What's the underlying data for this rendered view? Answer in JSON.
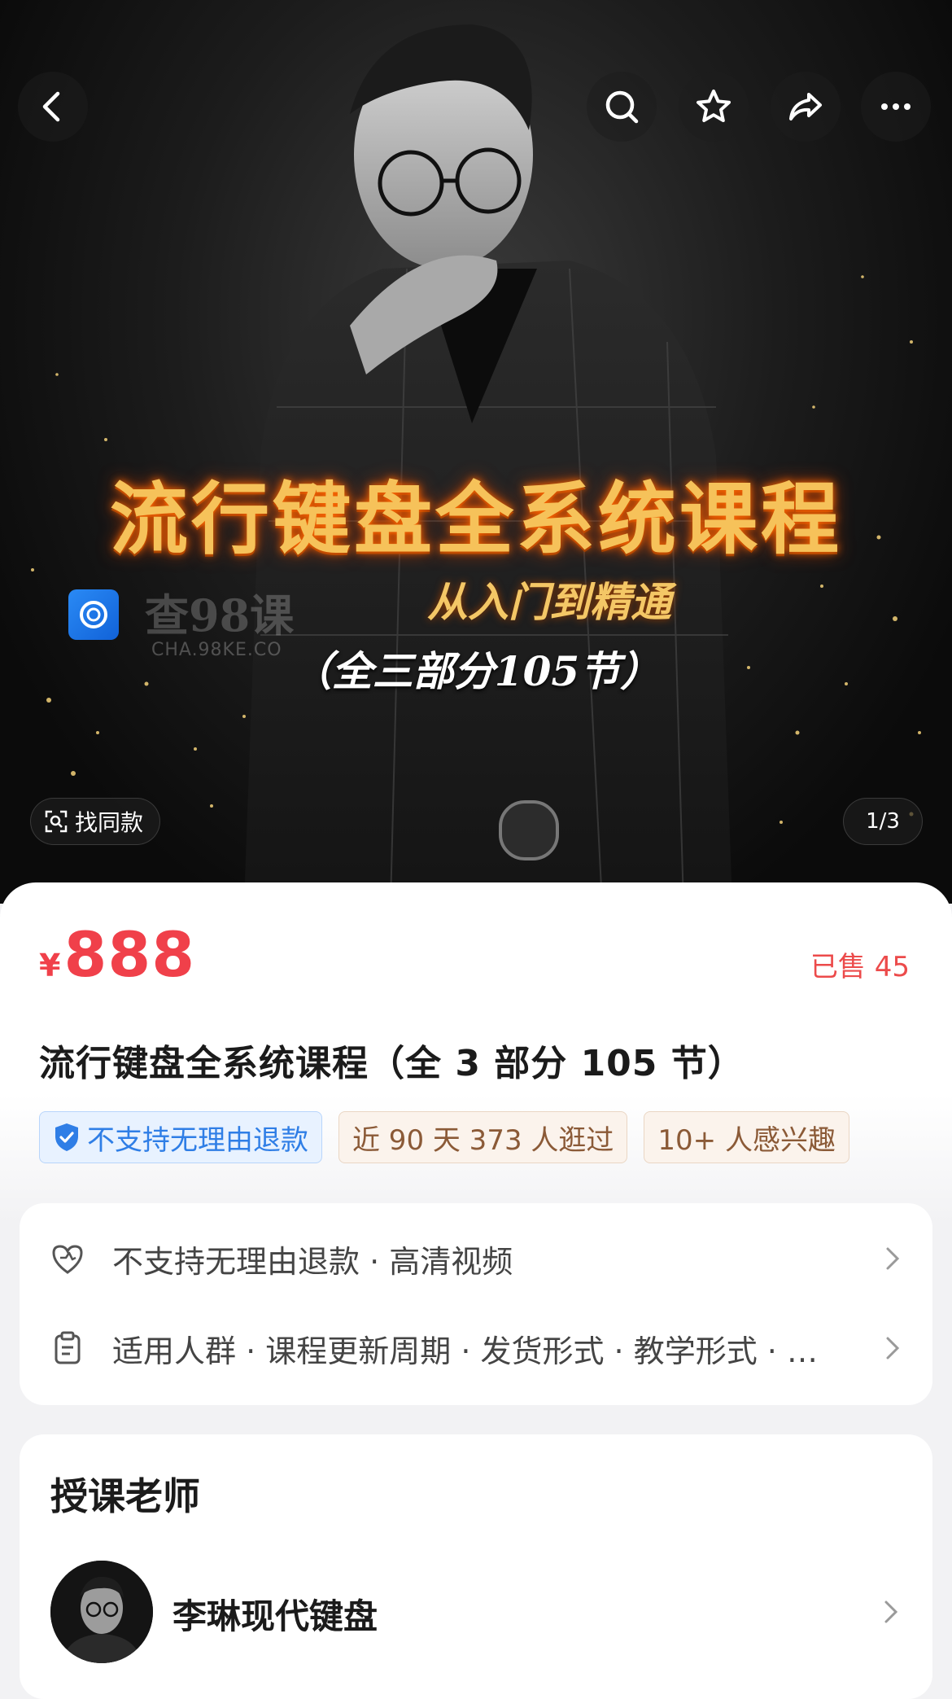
{
  "topbar": {
    "icons": [
      "back-icon",
      "search-icon",
      "star-icon",
      "share-icon",
      "more-icon"
    ]
  },
  "hero": {
    "title": "流行键盘全系统课程",
    "subtitle": "从入门到精通",
    "subtitle2": "（全三部分105节）",
    "watermark_text": "查98课",
    "watermark_url": "CHA.98KE.CO",
    "find_similar": "找同款",
    "page_indicator": "1/3"
  },
  "product": {
    "currency": "¥",
    "price": "888",
    "sold": "已售 45",
    "title": "流行键盘全系统课程（全 3 部分 105 节）",
    "tags": [
      {
        "label": "不支持无理由退款",
        "style": "blue"
      },
      {
        "label": "近 90 天 373 人逛过",
        "style": "brown"
      },
      {
        "label": "10+ 人感兴趣",
        "style": "brown"
      }
    ]
  },
  "info": {
    "rows": [
      {
        "icon": "heart-shield-icon",
        "text": "不支持无理由退款 · 高清视频"
      },
      {
        "icon": "clipboard-icon",
        "text": "适用人群 · 课程更新周期 · 发货形式 · 教学形式 · …"
      }
    ]
  },
  "teacher_section": {
    "title": "授课老师",
    "name": "李琳现代键盘"
  },
  "colors": {
    "price": "#f0404a",
    "tag_blue": "#2f7ee6",
    "tag_brown": "#8b5a37",
    "hero_title": "#f6c25a"
  }
}
